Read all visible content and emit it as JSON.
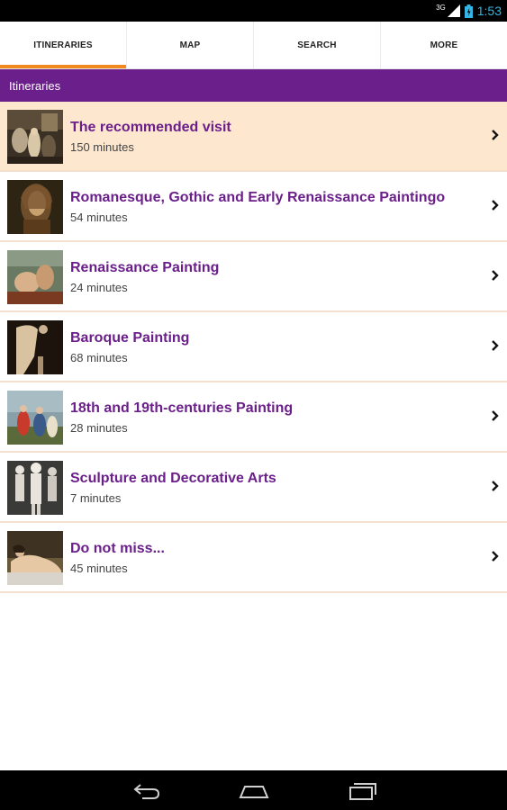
{
  "status_bar": {
    "network": "3G",
    "time": "1:53"
  },
  "tabs": [
    {
      "label": "ITINERARIES",
      "active": true
    },
    {
      "label": "MAP",
      "active": false
    },
    {
      "label": "SEARCH",
      "active": false
    },
    {
      "label": "MORE",
      "active": false
    }
  ],
  "section": {
    "title": "Itineraries"
  },
  "itineraries": [
    {
      "title": "The recommended visit",
      "duration": "150 minutes",
      "highlighted": true
    },
    {
      "title": "Romanesque, Gothic and Early Renaissance Paintingo",
      "duration": "54 minutes",
      "highlighted": false
    },
    {
      "title": "Renaissance Painting",
      "duration": "24 minutes",
      "highlighted": false
    },
    {
      "title": "Baroque Painting",
      "duration": "68 minutes",
      "highlighted": false
    },
    {
      "title": "18th and 19th-centuries Painting",
      "duration": "28 minutes",
      "highlighted": false
    },
    {
      "title": "Sculpture and Decorative Arts",
      "duration": "7 minutes",
      "highlighted": false
    },
    {
      "title": "Do not miss...",
      "duration": "45 minutes",
      "highlighted": false
    }
  ],
  "colors": {
    "accent": "#6b1f8a",
    "tab_indicator": "#f0891e",
    "highlight_row": "#fde8cf",
    "divider": "#f6dfcc"
  },
  "icons": {
    "row_chevron": "chevron-right-icon",
    "nav_back": "back-icon",
    "nav_home": "home-icon",
    "nav_recents": "recent-apps-icon"
  }
}
